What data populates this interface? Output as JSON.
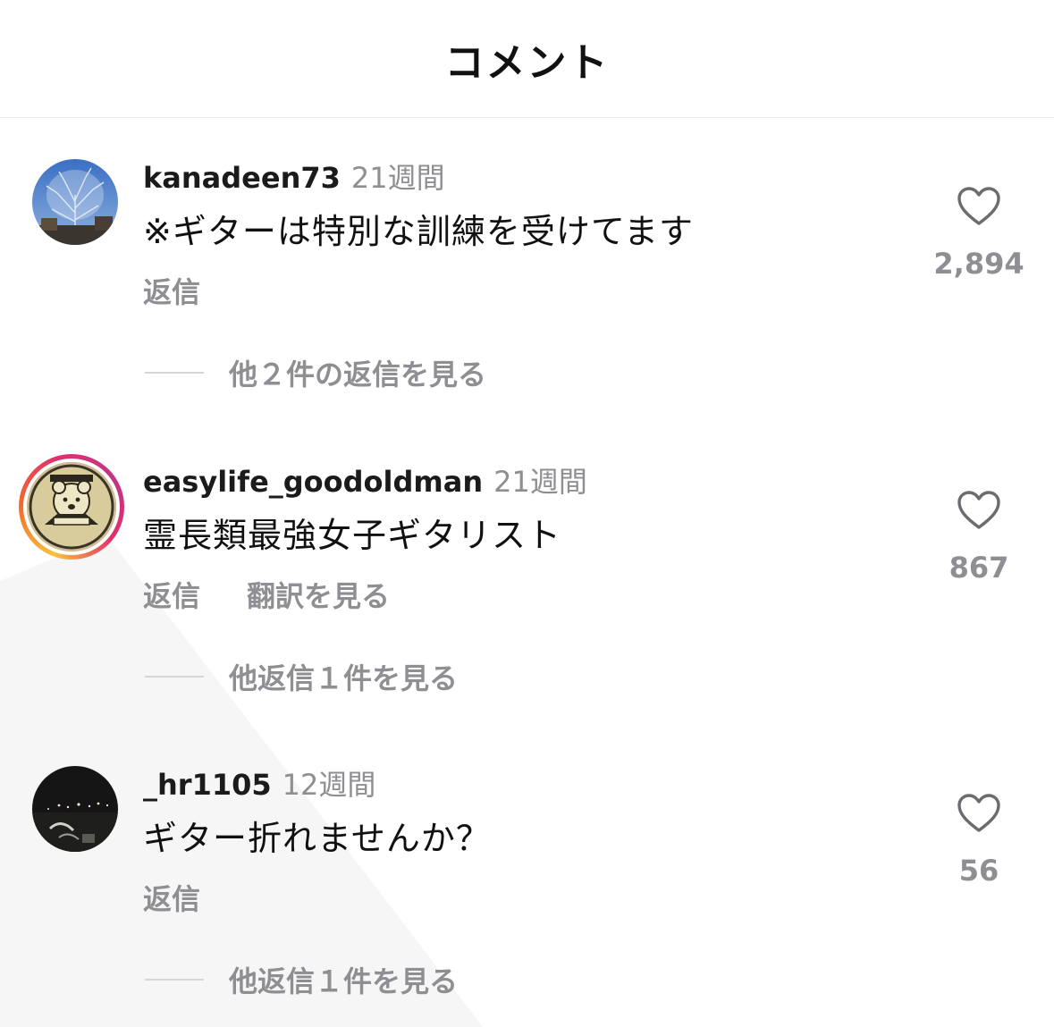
{
  "header": {
    "title": "コメント"
  },
  "comments": [
    {
      "username": "kanadeen73",
      "time": "21週間",
      "text": "※ギターは特別な訓練を受けてます",
      "reply_label": "返信",
      "translate_label": "",
      "more_replies": "他２件の返信を見る",
      "likes": "2,894",
      "avatar_icon": "winter-tree-avatar"
    },
    {
      "username": "easylife_goodoldman",
      "time": "21週間",
      "text": "霊長類最強女子ギタリスト",
      "reply_label": "返信",
      "translate_label": "翻訳を見る",
      "more_replies": "他返信１件を見る",
      "likes": "867",
      "avatar_icon": "bear-badge-avatar"
    },
    {
      "username": "_hr1105",
      "time": "12週間",
      "text": "ギター折れませんか？",
      "reply_label": "返信",
      "translate_label": "",
      "more_replies": "他返信１件を見る",
      "likes": "56",
      "avatar_icon": "night-scene-avatar"
    }
  ],
  "colors": {
    "muted": "#8e8e93",
    "story_ring": "#e1306c"
  }
}
